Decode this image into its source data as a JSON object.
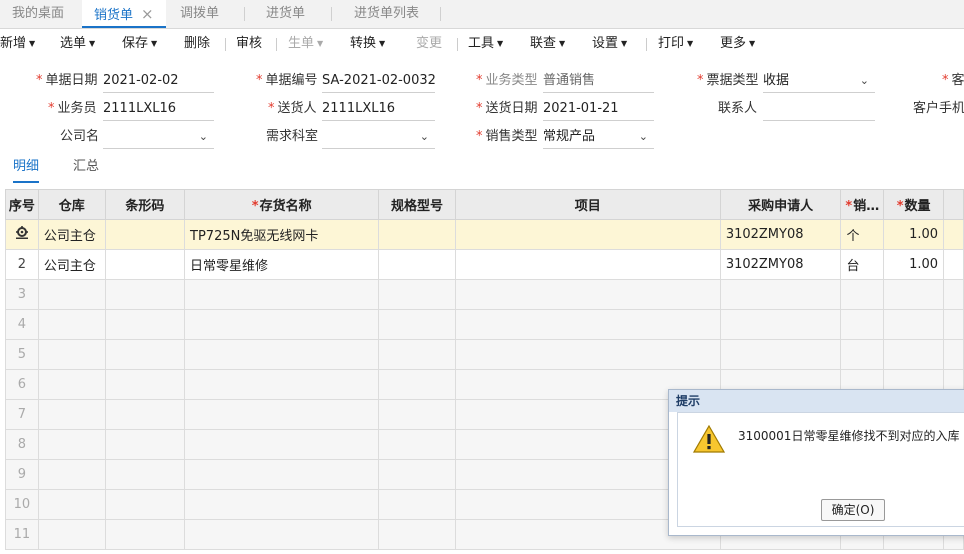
{
  "tabs": [
    {
      "label": "我的桌面"
    },
    {
      "label": "销货单",
      "close": "×"
    },
    {
      "label": "调拨单"
    },
    {
      "label": "进货单"
    },
    {
      "label": "进货单列表"
    }
  ],
  "toolbar": {
    "new": "新增",
    "select": "选单",
    "save": "保存",
    "delete": "删除",
    "audit": "审核",
    "generate": "生单",
    "convert": "转换",
    "change": "变更",
    "tools": "工具",
    "query": "联查",
    "settings": "设置",
    "print": "打印",
    "more": "更多",
    "caret": "▼"
  },
  "form": {
    "doc_date_label": "单据日期",
    "doc_date": "2021-02-02",
    "doc_no_label": "单据编号",
    "doc_no": "SA-2021-02-0032",
    "biz_type_label": "业务类型",
    "biz_type": "普通销售",
    "invoice_type_label": "票据类型",
    "invoice_type": "收据",
    "customer_label": "客",
    "salesman_label": "业务员",
    "salesman": "2111LXL16",
    "deliverer_label": "送货人",
    "deliverer": "2111LXL16",
    "delivery_date_label": "送货日期",
    "delivery_date": "2021-01-21",
    "contact_label": "联系人",
    "contact": "",
    "customer_phone_label": "客户手机",
    "company_label": "公司名",
    "company": "",
    "dept_label": "需求科室",
    "dept": "",
    "sales_type_label": "销售类型",
    "sales_type": "常规产品",
    "required_mark": "*",
    "dropdown": "⌄"
  },
  "subtabs": {
    "detail": "明细",
    "summary": "汇总"
  },
  "grid": {
    "headers": {
      "seq": "序号",
      "warehouse": "仓库",
      "barcode": "条形码",
      "item_name": "存货名称",
      "spec": "规格型号",
      "project": "项目",
      "purchaser": "采购申请人",
      "unit": "销…",
      "qty": "数量"
    },
    "rows": [
      {
        "seq": "",
        "warehouse": "公司主仓",
        "barcode": "",
        "item_name": "TP725N免驱无线网卡",
        "spec": "",
        "project": "",
        "purchaser": "3102ZMY08",
        "unit": "个",
        "qty": "1.00"
      },
      {
        "seq": "2",
        "warehouse": "公司主仓",
        "barcode": "",
        "item_name": "日常零星维修",
        "spec": "",
        "project": "",
        "purchaser": "3102ZMY08",
        "unit": "台",
        "qty": "1.00"
      }
    ],
    "empty_rows": [
      "3",
      "4",
      "5",
      "6",
      "7",
      "8",
      "9",
      "10",
      "11"
    ]
  },
  "dialog": {
    "title": "提示",
    "message": "3100001日常零星维修找不到对应的入库",
    "ok_label": "确定(O)"
  }
}
